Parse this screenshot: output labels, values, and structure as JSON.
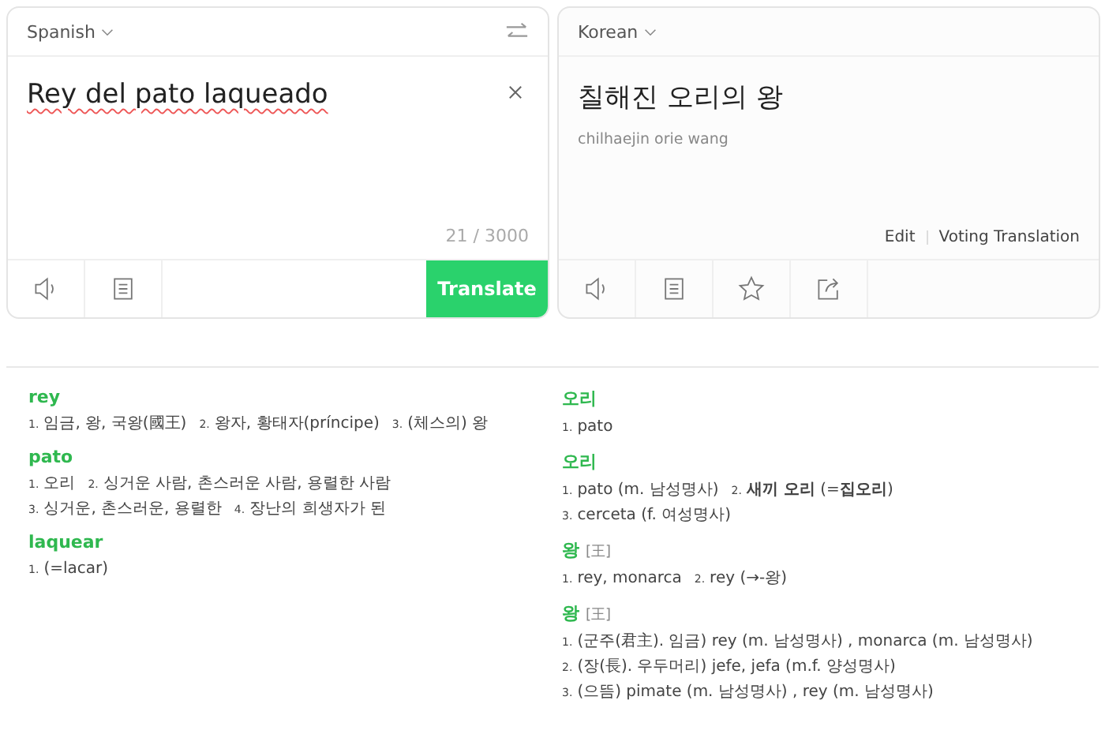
{
  "source": {
    "language": "Spanish",
    "text": "Rey del pato laqueado",
    "counter": "21 / 3000",
    "translate_button": "Translate"
  },
  "target": {
    "language": "Korean",
    "text": "칠해진 오리의 왕",
    "romanization": "chilhaejin orie wang",
    "links": [
      "Edit",
      "Voting Translation"
    ]
  },
  "dictionary": {
    "left": [
      {
        "word": "rey",
        "lines": [
          [
            {
              "number": "1.",
              "text": "임금, 왕, 국왕(國王)"
            },
            {
              "number": "2.",
              "text": "왕자, 황태자(príncipe)"
            },
            {
              "number": "3.",
              "text": "(체스의) 왕"
            }
          ]
        ]
      },
      {
        "word": "pato",
        "lines": [
          [
            {
              "number": "1.",
              "text": "오리"
            },
            {
              "number": "2.",
              "text": "싱거운 사람, 촌스러운 사람, 용렬한 사람"
            }
          ],
          [
            {
              "number": "3.",
              "text": "싱거운, 촌스러운, 용렬한"
            },
            {
              "number": "4.",
              "text": "장난의 희생자가 된"
            }
          ]
        ]
      },
      {
        "word": "laquear",
        "lines": [
          [
            {
              "number": "1.",
              "text": "(=lacar)"
            }
          ]
        ]
      }
    ],
    "right": [
      {
        "word": "오리",
        "lines": [
          [
            {
              "number": "1.",
              "text": "pato"
            }
          ]
        ]
      },
      {
        "word": "오리",
        "lines": [
          [
            {
              "number": "1.",
              "text": "pato (m. 남성명사)"
            },
            {
              "number": "2.",
              "text": "**새끼 오리** (=**집오리**)"
            }
          ],
          [
            {
              "number": "3.",
              "text": "cerceta (f. 여성명사)"
            }
          ]
        ]
      },
      {
        "word": "왕",
        "hanja": "[王]",
        "lines": [
          [
            {
              "number": "1.",
              "text": "rey, monarca"
            },
            {
              "number": "2.",
              "text": "rey (→-왕)"
            }
          ]
        ]
      },
      {
        "word": "왕",
        "hanja": "[王]",
        "lines": [
          [
            {
              "number": "1.",
              "text": "(군주(君主). 임금) rey (m. 남성명사) , monarca (m. 남성명사)"
            }
          ],
          [
            {
              "number": "2.",
              "text": "(장(長). 우두머리) jefe, jefa (m.f. 양성명사)"
            }
          ],
          [
            {
              "number": "3.",
              "text": "(으뜸) pimate (m. 남성명사) , rey (m. 남성명사)"
            }
          ]
        ]
      }
    ]
  }
}
